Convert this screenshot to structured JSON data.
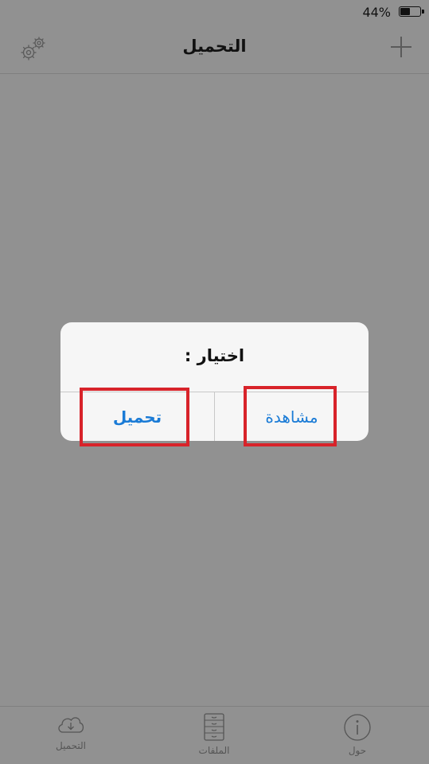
{
  "status_bar": {
    "battery_percent": "44%"
  },
  "nav": {
    "title": "التحميل"
  },
  "dialog": {
    "title": "اختيار :",
    "download_label": "تحميل",
    "watch_label": "مشاهدة"
  },
  "tabs": [
    {
      "label": "التحميل",
      "icon": "cloud-download-icon"
    },
    {
      "label": "الملفات",
      "icon": "file-cabinet-icon"
    },
    {
      "label": "حول",
      "icon": "info-icon"
    }
  ],
  "colors": {
    "accent": "#1a7bd6",
    "highlight": "#d8232a",
    "overlay": "#919191"
  }
}
